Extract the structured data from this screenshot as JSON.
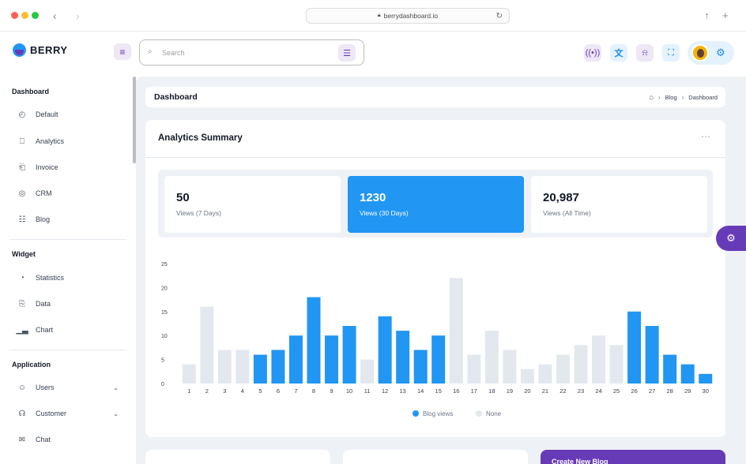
{
  "browser": {
    "url": "berrydashboard.io",
    "dots": [
      "#ff5f57",
      "#febc2e",
      "#28c840"
    ]
  },
  "header": {
    "logo": "BERRY",
    "search_placeholder": "Search",
    "icons": [
      "hamburger-icon",
      "filter-icon",
      "broadcast-icon",
      "translate-icon",
      "bell-icon",
      "fullscreen-icon",
      "settings-icon"
    ]
  },
  "sidebar": {
    "sections": [
      {
        "title": "Dashboard",
        "items": [
          {
            "label": "Default",
            "icon": "dashboard-icon"
          },
          {
            "label": "Analytics",
            "icon": "presentation-icon"
          },
          {
            "label": "Invoice",
            "icon": "invoice-icon"
          },
          {
            "label": "CRM",
            "icon": "crm-icon"
          },
          {
            "label": "Blog",
            "icon": "blog-icon"
          }
        ]
      },
      {
        "title": "Widget",
        "items": [
          {
            "label": "Statistics",
            "icon": "statistics-icon"
          },
          {
            "label": "Data",
            "icon": "data-icon"
          },
          {
            "label": "Chart",
            "icon": "chart-icon"
          }
        ]
      },
      {
        "title": "Application",
        "items": [
          {
            "label": "Users",
            "icon": "users-icon",
            "expandable": true
          },
          {
            "label": "Customer",
            "icon": "customer-icon",
            "expandable": true
          },
          {
            "label": "Chat",
            "icon": "chat-icon"
          }
        ]
      }
    ]
  },
  "breadcrumb": {
    "title": "Dashboard",
    "trail": [
      "Blog",
      "Dashboard"
    ]
  },
  "analytics": {
    "title": "Analytics Summary",
    "stats": [
      {
        "value": "50",
        "label": "Views (7 Days)",
        "active": false
      },
      {
        "value": "1230",
        "label": "Views (30 Days)",
        "active": true
      },
      {
        "value": "20,987",
        "label": "Views (All Time)",
        "active": false
      }
    ]
  },
  "bottom": {
    "card_label": "Create New Blog"
  },
  "chart_data": {
    "type": "bar",
    "categories": [
      "1",
      "2",
      "3",
      "4",
      "5",
      "6",
      "7",
      "8",
      "9",
      "10",
      "11",
      "12",
      "13",
      "14",
      "15",
      "16",
      "17",
      "18",
      "19",
      "20",
      "21",
      "22",
      "23",
      "24",
      "25",
      "26",
      "27",
      "28",
      "29",
      "30"
    ],
    "values": [
      4,
      16,
      7,
      7,
      6,
      7,
      10,
      18,
      10,
      12,
      5,
      14,
      11,
      7,
      10,
      22,
      6,
      11,
      7,
      3,
      4,
      6,
      8,
      10,
      8,
      15,
      12,
      6,
      4,
      2
    ],
    "series_membership": [
      "None",
      "None",
      "None",
      "None",
      "Blog views",
      "Blog views",
      "Blog views",
      "Blog views",
      "Blog views",
      "Blog views",
      "None",
      "Blog views",
      "Blog views",
      "Blog views",
      "Blog views",
      "None",
      "None",
      "None",
      "None",
      "None",
      "None",
      "None",
      "None",
      "None",
      "None",
      "Blog views",
      "Blog views",
      "Blog views",
      "Blog views",
      "Blog views"
    ],
    "legend": [
      "Blog views",
      "None"
    ],
    "colors": {
      "Blog views": "#2196f3",
      "None": "#e3e8ef"
    },
    "yticks": [
      0,
      5,
      10,
      15,
      20,
      25
    ],
    "ylim": [
      0,
      25
    ],
    "legend_position": "bottom-center",
    "grid": false
  }
}
